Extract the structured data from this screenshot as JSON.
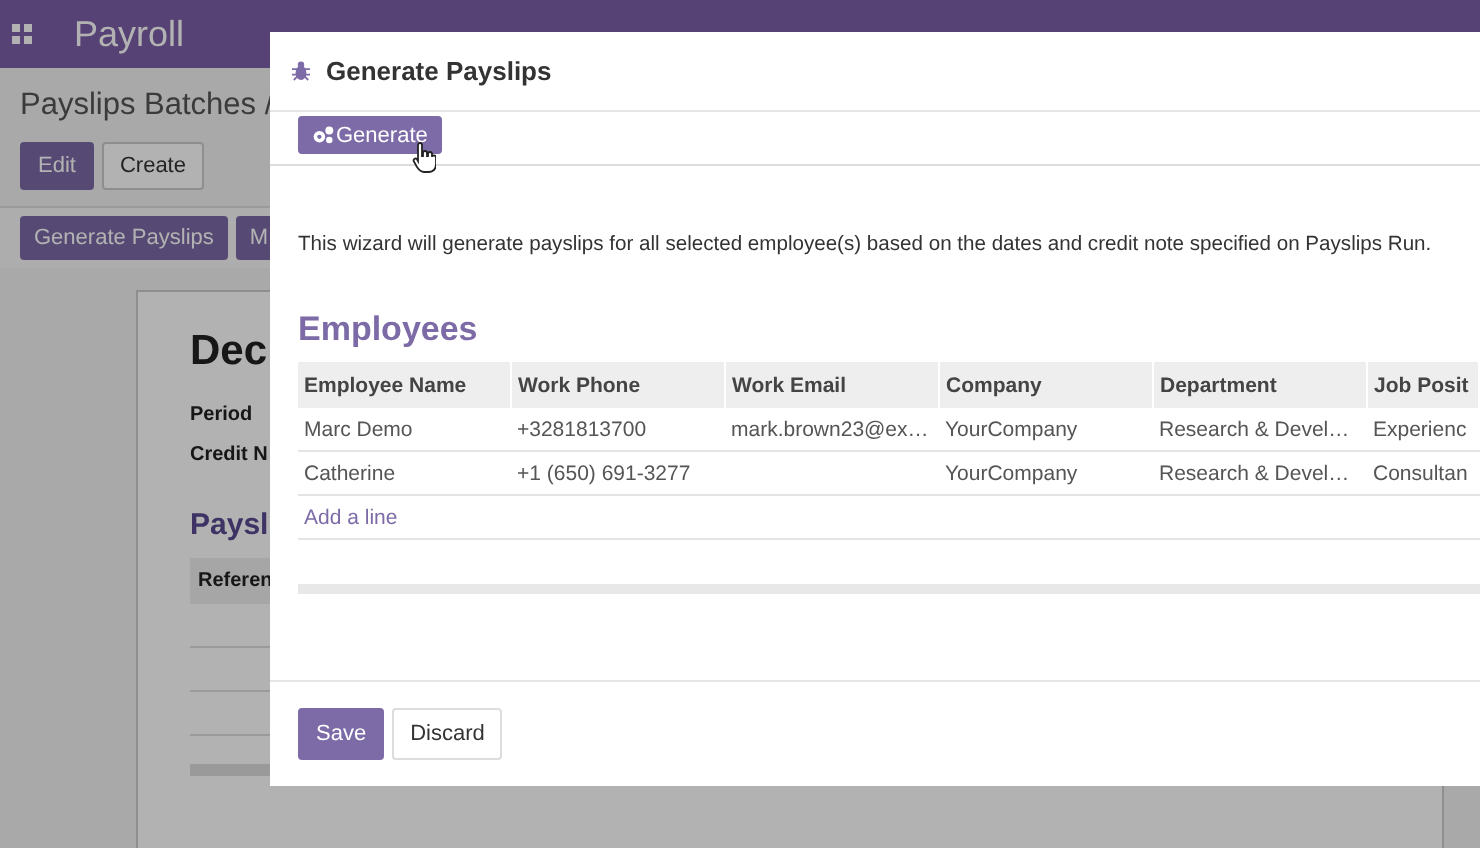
{
  "navbar": {
    "app_title": "Payroll"
  },
  "page": {
    "breadcrumb": "Payslips Batches /",
    "buttons": [
      "Edit",
      "Create"
    ],
    "action_buttons": [
      "Generate Payslips",
      "M"
    ],
    "form": {
      "title": "Dec",
      "fields": [
        "Period",
        "Credit N"
      ],
      "section_title": "Paysl",
      "column": "Referen"
    }
  },
  "dialog": {
    "title": "Generate Payslips",
    "generate_button": "Generate",
    "description": "This wizard will generate payslips for all selected employee(s) based on the dates and credit note specified on Payslips Run.",
    "section_title": "Employees",
    "table": {
      "columns": [
        "Employee Name",
        "Work Phone",
        "Work Email",
        "Company",
        "Department",
        "Job Posit"
      ],
      "rows": [
        [
          "Marc Demo",
          "+3281813700",
          "mark.brown23@ex…",
          "YourCompany",
          "Research & Devel…",
          "Experienc"
        ],
        [
          "Catherine",
          "+1 (650) 691-3277",
          "",
          "YourCompany",
          "Research & Devel…",
          "Consultan"
        ]
      ],
      "add_line": "Add a line"
    },
    "footer_buttons": [
      {
        "label": "Save",
        "kind": "primary"
      },
      {
        "label": "Discard",
        "kind": "secondary"
      }
    ]
  }
}
